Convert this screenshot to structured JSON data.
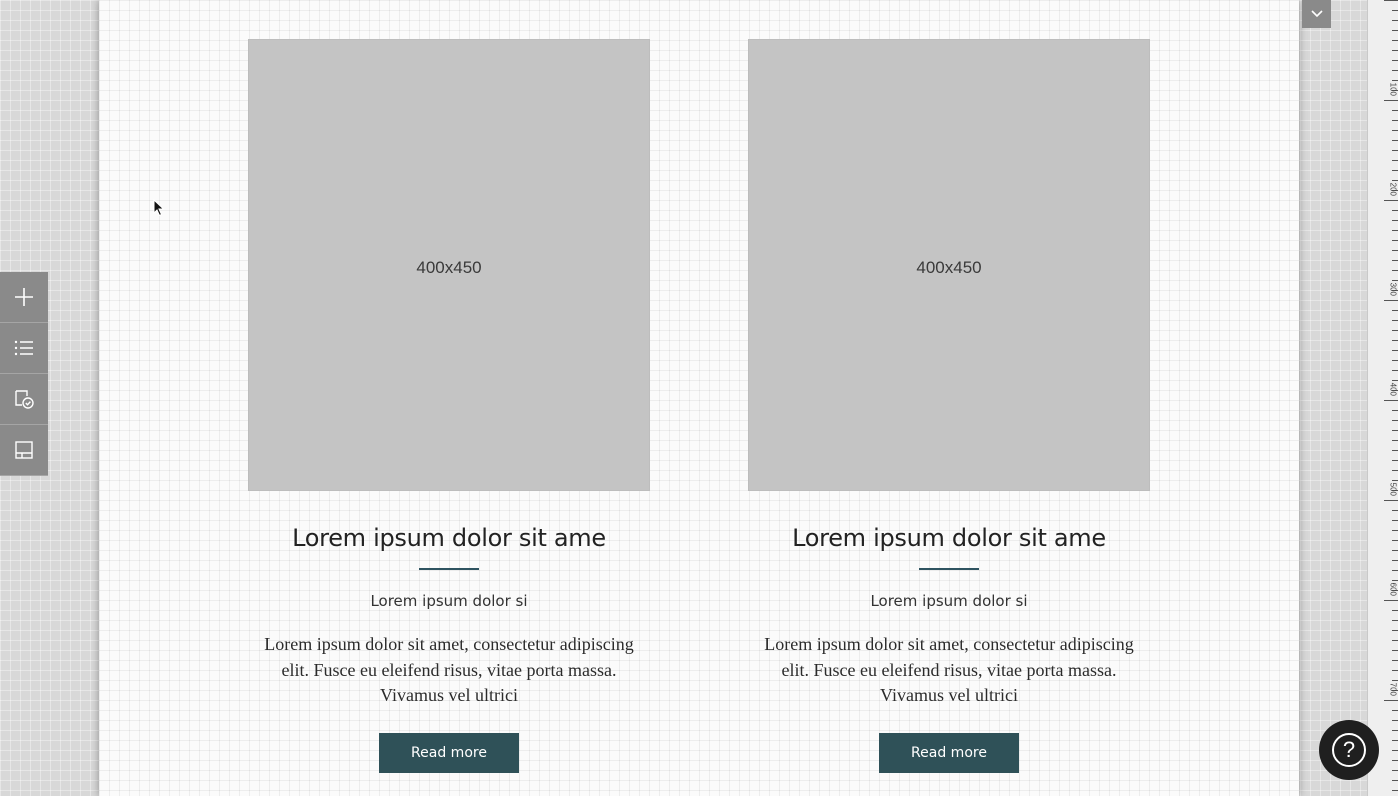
{
  "cards": [
    {
      "image_label": "400x450",
      "title": "Lorem ipsum dolor sit ame",
      "subtitle": "Lorem ipsum dolor si",
      "body": "Lorem ipsum dolor sit amet, consectetur adipiscing elit. Fusce eu eleifend risus, vitae porta massa. Vivamus vel ultrici",
      "button_label": "Read more"
    },
    {
      "image_label": "400x450",
      "title": "Lorem ipsum dolor sit ame",
      "subtitle": "Lorem ipsum dolor si",
      "body": "Lorem ipsum dolor sit amet, consectetur adipiscing elit. Fusce eu eleifend risus, vitae porta massa. Vivamus vel ultrici",
      "button_label": "Read more"
    }
  ],
  "toolbar": {
    "items": [
      {
        "icon": "plus-icon"
      },
      {
        "icon": "list-icon"
      },
      {
        "icon": "checklist-icon"
      },
      {
        "icon": "layout-icon"
      }
    ]
  },
  "ruler": {
    "labels": [
      "100",
      "200",
      "300",
      "400",
      "500",
      "600",
      "700"
    ]
  },
  "help": {
    "label": "?"
  },
  "colors": {
    "accent": "#2f5158",
    "divider": "#2e5360",
    "placeholder": "#c4c4c4",
    "toolbar": "#8a8a8a",
    "help_button": "#1f1f1f"
  }
}
